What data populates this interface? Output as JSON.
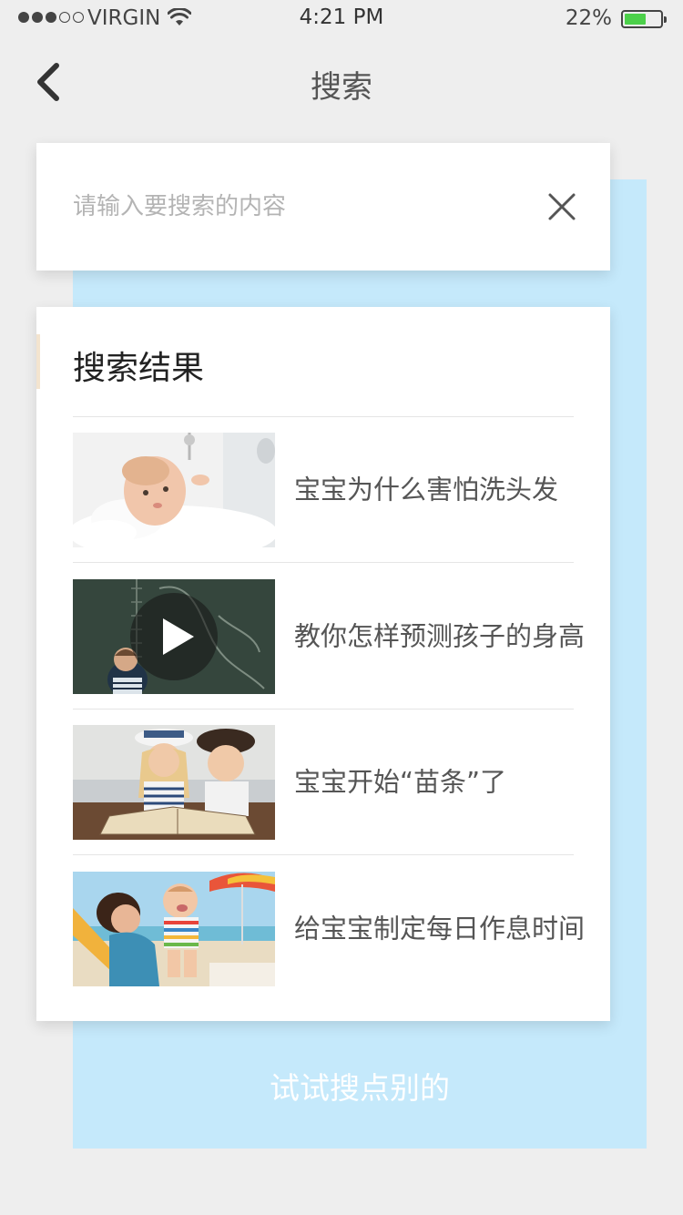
{
  "status_bar": {
    "carrier": "VIRGIN",
    "time": "4:21 PM",
    "battery_percent": "22%",
    "battery_level": 0.22,
    "signal_bars_filled": 3,
    "signal_bars_total": 5
  },
  "nav": {
    "title": "搜索",
    "back_icon": "chevron-left-icon"
  },
  "search": {
    "placeholder": "请输入要搜索的内容",
    "value": "",
    "clear_icon": "close-icon"
  },
  "results": {
    "title": "搜索结果",
    "items": [
      {
        "title": "宝宝为什么害怕洗头发",
        "thumbnail": "baby-bath-image",
        "is_video": false
      },
      {
        "title": "教你怎样预测孩子的身高",
        "thumbnail": "child-chalkboard-image",
        "is_video": true
      },
      {
        "title": "宝宝开始“苗条”了",
        "thumbnail": "kids-reading-image",
        "is_video": false
      },
      {
        "title": "给宝宝制定每日作息时间",
        "thumbnail": "mother-baby-beach-image",
        "is_video": false
      }
    ]
  },
  "footer": {
    "try_other_label": "试试搜点别的"
  },
  "colors": {
    "background": "#eeeeee",
    "panel_blue": "#c5e9fb",
    "card": "#ffffff",
    "accent": "#f3e4cf",
    "battery_green": "#4cd04a"
  }
}
